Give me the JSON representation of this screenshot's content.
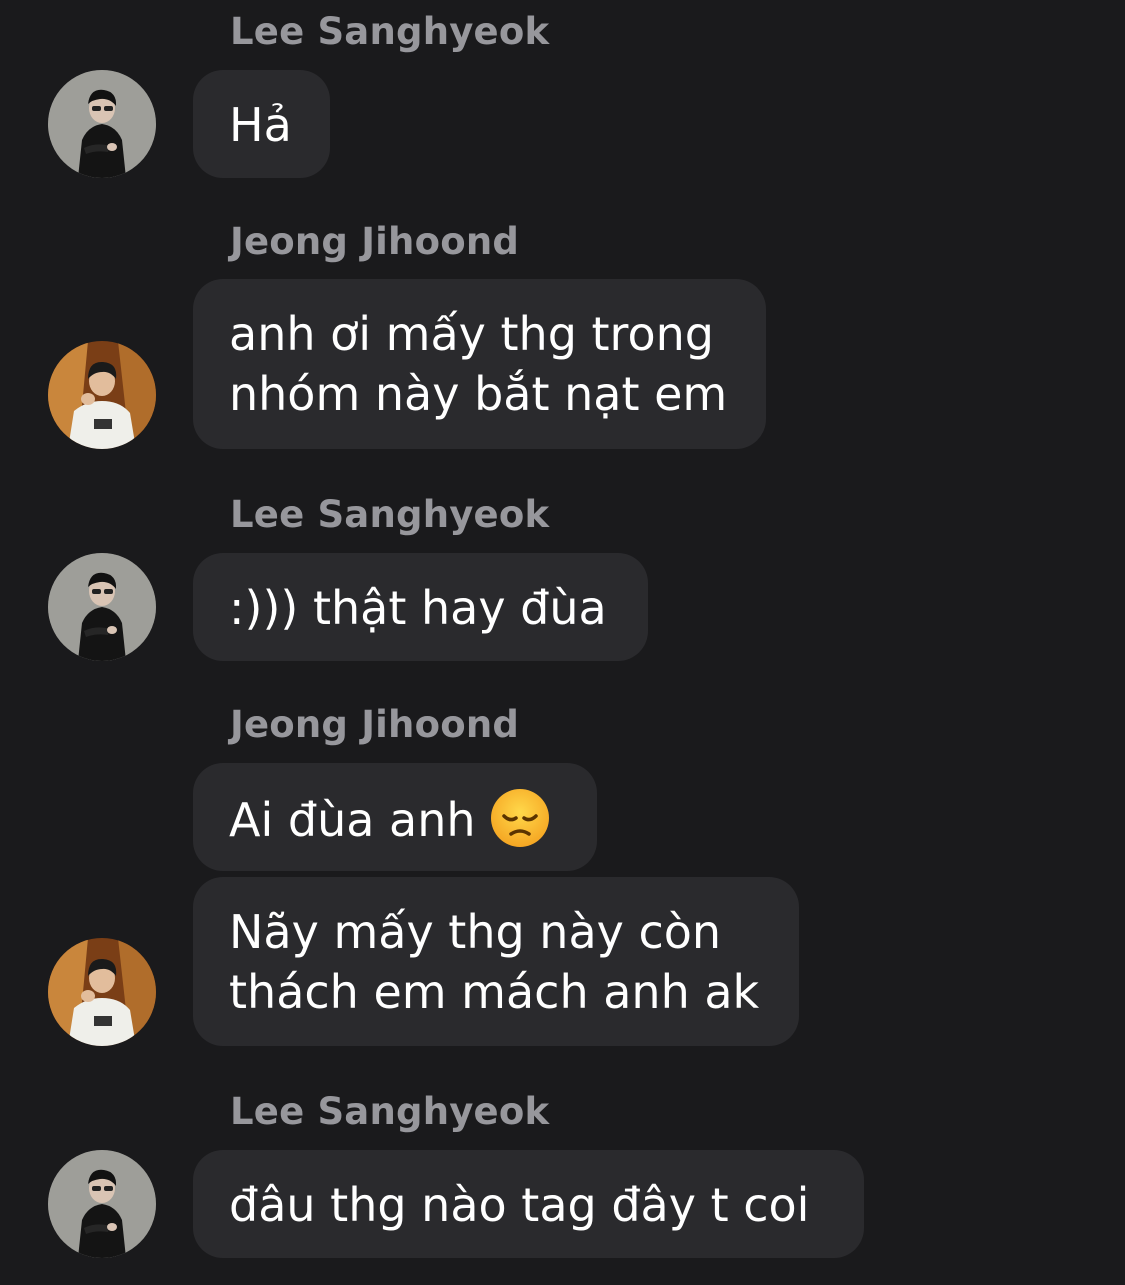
{
  "messages": [
    {
      "sender": "Lee Sanghyeok",
      "lines": [
        "Hả"
      ],
      "avatar": "user-photo-lee-sanghyeok"
    },
    {
      "sender": "Jeong Jihoond",
      "lines": [
        "anh ơi mấy thg trong",
        "nhóm này bắt nạt em"
      ],
      "avatar": "user-photo-jeong-jihoond"
    },
    {
      "sender": "Lee Sanghyeok",
      "lines": [
        ":))) thật hay đùa"
      ],
      "avatar": "user-photo-lee-sanghyeok"
    },
    {
      "sender": "Jeong Jihoond",
      "lines": [
        "Ai đùa anh"
      ],
      "emoji": "disappointed-face-emoji"
    },
    {
      "lines": [
        "Nãy mấy thg này còn",
        "thách em mách anh ak"
      ],
      "avatar": "user-photo-jeong-jihoond"
    },
    {
      "sender": "Lee Sanghyeok",
      "lines": [
        "đâu thg nào tag đây t coi"
      ],
      "avatar": "user-photo-lee-sanghyeok"
    }
  ],
  "colors": {
    "background": "#1a1a1c",
    "bubble": "#2a2a2d",
    "sender_name": "#97979c",
    "message_text": "#ffffff"
  }
}
